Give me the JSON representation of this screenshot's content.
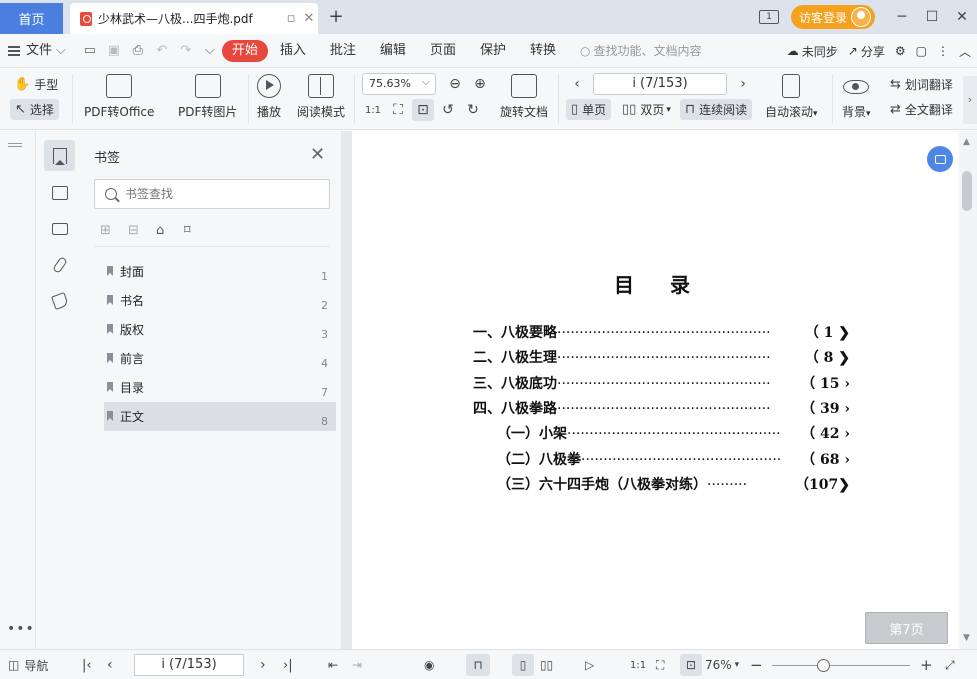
{
  "titlebar": {
    "home_tab": "首页",
    "doc_tab_title": "少林武术—八极...四手炮.pdf",
    "new_tab": "+",
    "screen_badge": "1",
    "guest_login": "访客登录"
  },
  "menubar": {
    "file": "文件",
    "items": [
      "开始",
      "插入",
      "批注",
      "编辑",
      "页面",
      "保护",
      "转换"
    ],
    "search_placeholder": "查找功能、文档内容",
    "sync": "未同步",
    "share": "分享"
  },
  "toolbar": {
    "hand": "手型",
    "select": "选择",
    "pdf_to_office": "PDF转Office",
    "pdf_to_image": "PDF转图片",
    "play": "播放",
    "read_mode": "阅读模式",
    "zoom": "75.63%",
    "page": "i (7/153)",
    "rotate_doc": "旋转文档",
    "single_page": "单页",
    "double_page": "双页",
    "continuous": "连续阅读",
    "auto_scroll": "自动滚动",
    "background": "背景",
    "word_translate": "划词翻译",
    "full_translate": "全文翻译"
  },
  "bookmark_panel": {
    "title": "书签",
    "search_placeholder": "书签查找",
    "items": [
      {
        "label": "封面",
        "page": "1"
      },
      {
        "label": "书名",
        "page": "2"
      },
      {
        "label": "版权",
        "page": "3"
      },
      {
        "label": "前言",
        "page": "4"
      },
      {
        "label": "目录",
        "page": "7"
      },
      {
        "label": "正文",
        "page": "8"
      }
    ],
    "selected_index": 5
  },
  "document": {
    "toc_title": "目录",
    "toc": [
      {
        "label": "一、八极要略",
        "num": "（ 1 ❯"
      },
      {
        "label": "二、八极生理",
        "num": "（ 8 ❯"
      },
      {
        "label": "三、八极底功",
        "num": "（ 15 ›"
      },
      {
        "label": "四、八极拳路",
        "num": "（ 39 ›"
      },
      {
        "label": "（一）小架",
        "num": "（ 42 ›"
      },
      {
        "label": "（二）八极拳",
        "num": "（ 68 ›"
      },
      {
        "label": "（三）六十四手炮（八极拳对练）",
        "num": "（107❯"
      }
    ],
    "page_indicator": "第7页"
  },
  "statusbar": {
    "nav": "导航",
    "page": "i (7/153)",
    "zoom": "76%"
  },
  "colors": {
    "accent_blue": "#4a7fe0",
    "active_red": "#e8473d",
    "guest_orange": "#f4a11d"
  }
}
